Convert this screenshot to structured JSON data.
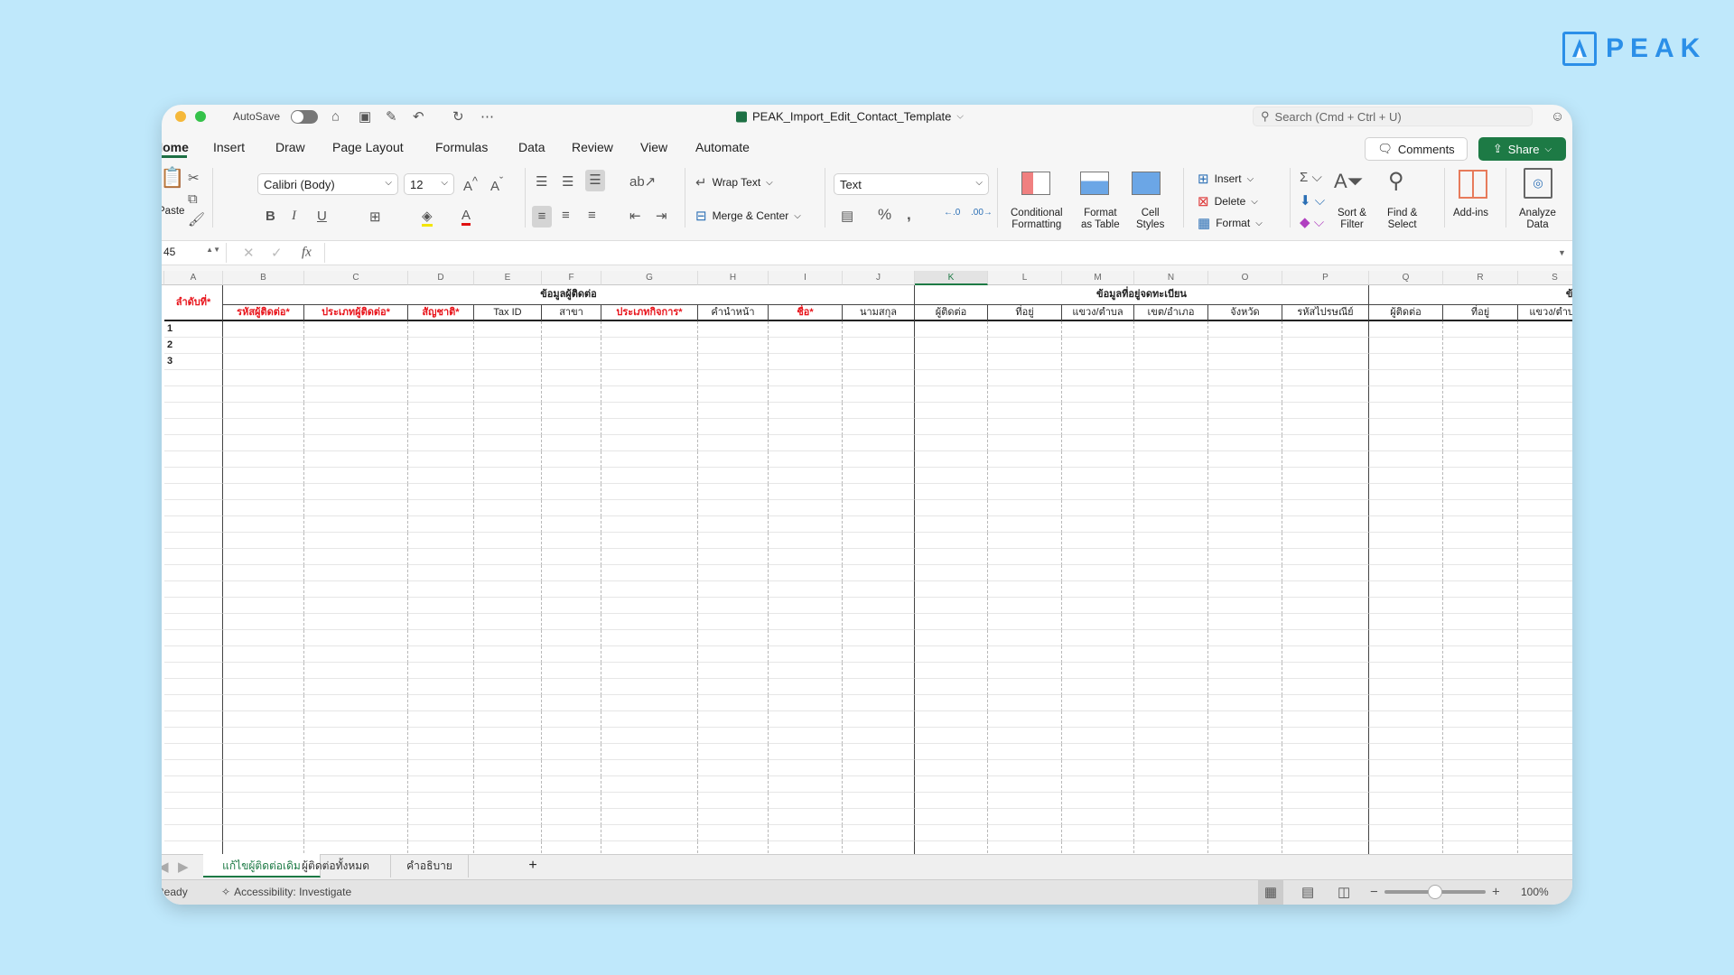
{
  "logo": {
    "text": "PEAK",
    "color": "#2b8fe8"
  },
  "titlebar": {
    "autosave_label": "AutoSave",
    "autosave_on": false,
    "file_name": "PEAK_Import_Edit_Contact_Template",
    "search_placeholder": "Search (Cmd + Ctrl + U)"
  },
  "menu": {
    "tabs": [
      "Home",
      "Insert",
      "Draw",
      "Page Layout",
      "Formulas",
      "Data",
      "Review",
      "View",
      "Automate"
    ],
    "active": "Home",
    "comments": "Comments",
    "share": "Share"
  },
  "ribbon": {
    "paste": "Paste",
    "font_name": "Calibri (Body)",
    "font_size": "12",
    "bold": "B",
    "italic": "I",
    "underline": "U",
    "wrap_text": "Wrap Text",
    "merge_center": "Merge & Center",
    "number_format": "Text",
    "conditional_formatting": [
      "Conditional",
      "Formatting"
    ],
    "format_as_table": [
      "Format",
      "as Table"
    ],
    "cell_styles": [
      "Cell",
      "Styles"
    ],
    "insert": "Insert",
    "delete": "Delete",
    "format": "Format",
    "sort_filter": [
      "Sort &",
      "Filter"
    ],
    "find_select": [
      "Find &",
      "Select"
    ],
    "add_ins": "Add-ins",
    "analyze_data": [
      "Analyze",
      "Data"
    ]
  },
  "formula_bar": {
    "name_box": "45",
    "fx": "fx",
    "value": ""
  },
  "sheet": {
    "columns": [
      "A",
      "B",
      "C",
      "D",
      "E",
      "F",
      "G",
      "H",
      "I",
      "J",
      "K",
      "L",
      "M",
      "N",
      "O",
      "P",
      "Q",
      "R",
      "S"
    ],
    "selected_column": "K",
    "row_a_header": {
      "text": "ลำดับที่*",
      "required": true
    },
    "groups": [
      {
        "text": "ข้อมูลผู้ติดต่อ",
        "from": "B",
        "to": "J"
      },
      {
        "text": "ข้อมูลที่อยู่จดทะเบียน",
        "from": "K",
        "to": "P"
      },
      {
        "text": "ข้อมูล",
        "from": "Q",
        "to": "S"
      }
    ],
    "headers": [
      {
        "col": "B",
        "text": "รหัสผู้ติดต่อ*",
        "required": true
      },
      {
        "col": "C",
        "text": "ประเภทผู้ติดต่อ*",
        "required": true
      },
      {
        "col": "D",
        "text": "สัญชาติ*",
        "required": true
      },
      {
        "col": "E",
        "text": "Tax ID",
        "required": false
      },
      {
        "col": "F",
        "text": "สาขา",
        "required": false
      },
      {
        "col": "G",
        "text": "ประเภทกิจการ*",
        "required": true
      },
      {
        "col": "H",
        "text": "คำนำหน้า",
        "required": false
      },
      {
        "col": "I",
        "text": "ชื่อ*",
        "required": true
      },
      {
        "col": "J",
        "text": "นามสกุล",
        "required": false
      },
      {
        "col": "K",
        "text": "ผู้ติดต่อ",
        "required": false
      },
      {
        "col": "L",
        "text": "ที่อยู่",
        "required": false
      },
      {
        "col": "M",
        "text": "แขวง/ตำบล",
        "required": false
      },
      {
        "col": "N",
        "text": "เขต/อำเภอ",
        "required": false
      },
      {
        "col": "O",
        "text": "จังหวัด",
        "required": false
      },
      {
        "col": "P",
        "text": "รหัสไปรษณีย์",
        "required": false
      },
      {
        "col": "Q",
        "text": "ผู้ติดต่อ",
        "required": false
      },
      {
        "col": "R",
        "text": "ที่อยู่",
        "required": false
      },
      {
        "col": "S",
        "text": "แขวง/ตำบล",
        "required": false
      }
    ],
    "row_numbers": [
      "1",
      "2",
      "3"
    ],
    "required_color": "#e8141b"
  },
  "sheet_tabs": {
    "tabs": [
      "แก้ไขผู้ติดต่อเดิม",
      "ผู้ติดต่อทั้งหมด",
      "คำอธิบาย"
    ],
    "active": 0,
    "add": "+"
  },
  "status": {
    "ready": "Ready",
    "accessibility": "Accessibility: Investigate",
    "zoom": "100%",
    "zoom_level": 100
  }
}
